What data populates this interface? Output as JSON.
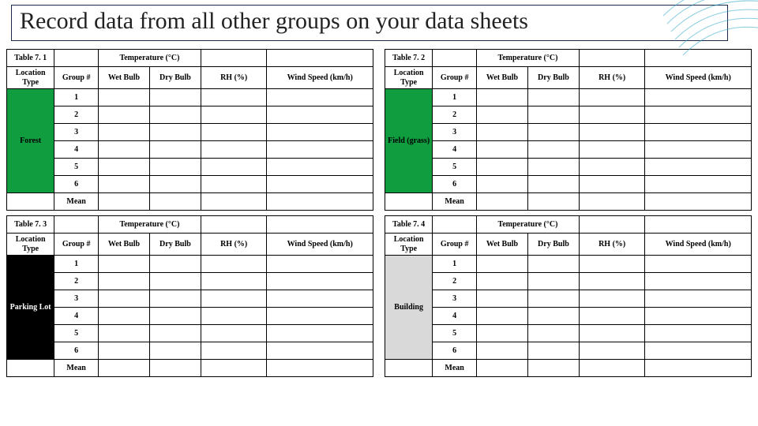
{
  "title": "Record data from all other groups on your data sheets",
  "common": {
    "temp_header": "Temperature (°C)",
    "col_location": "Location Type",
    "col_group": "Group #",
    "col_wet": "Wet Bulb",
    "col_dry": "Dry Bulb",
    "col_rh": "RH (%)",
    "col_wind": "Wind Speed (km/h)",
    "row_mean": "Mean",
    "groups": [
      "1",
      "2",
      "3",
      "4",
      "5",
      "6"
    ]
  },
  "tables": {
    "t1": {
      "label": "Table 7. 1",
      "location": "Forest",
      "loc_class": "loc-green"
    },
    "t2": {
      "label": "Table 7. 2",
      "location": "Field (grass)",
      "loc_class": "loc-green"
    },
    "t3": {
      "label": "Table 7. 3",
      "location": "Parking Lot",
      "loc_class": "loc-black"
    },
    "t4": {
      "label": "Table 7. 4",
      "location": "Building",
      "loc_class": "loc-gray"
    }
  },
  "chart_data": {
    "type": "table",
    "note": "Four empty data-recording tables; all measurement cells are blank in the image.",
    "tables": [
      {
        "id": "7.1",
        "location": "Forest",
        "rows": 6,
        "columns": [
          "Group #",
          "Wet Bulb (°C)",
          "Dry Bulb (°C)",
          "RH (%)",
          "Wind Speed (km/h)"
        ],
        "values": []
      },
      {
        "id": "7.2",
        "location": "Field (grass)",
        "rows": 6,
        "columns": [
          "Group #",
          "Wet Bulb (°C)",
          "Dry Bulb (°C)",
          "RH (%)",
          "Wind Speed (km/h)"
        ],
        "values": []
      },
      {
        "id": "7.3",
        "location": "Parking Lot",
        "rows": 6,
        "columns": [
          "Group #",
          "Wet Bulb (°C)",
          "Dry Bulb (°C)",
          "RH (%)",
          "Wind Speed (km/h)"
        ],
        "values": []
      },
      {
        "id": "7.4",
        "location": "Building",
        "rows": 6,
        "columns": [
          "Group #",
          "Wet Bulb (°C)",
          "Dry Bulb (°C)",
          "RH (%)",
          "Wind Speed (km/h)"
        ],
        "values": []
      }
    ]
  }
}
